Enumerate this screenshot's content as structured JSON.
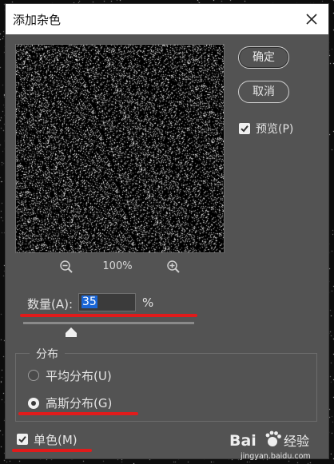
{
  "dialog": {
    "title": "添加杂色"
  },
  "buttons": {
    "ok_label": "确定",
    "cancel_label": "取消"
  },
  "preview": {
    "label": "预览(P)",
    "checked": true
  },
  "zoom": {
    "level": "100%"
  },
  "amount": {
    "label": "数量(A):",
    "value": "35",
    "unit": "%",
    "slider_value_percent": 35
  },
  "distribution": {
    "title": "分布",
    "options": [
      {
        "label": "平均分布(U)",
        "selected": false
      },
      {
        "label": "高斯分布(G)",
        "selected": true
      }
    ]
  },
  "monochromatic": {
    "label": "单色(M)",
    "checked": true
  },
  "watermark": {
    "brand": "Bai",
    "brand2": "经验",
    "url": "jingyan.baidu.com"
  },
  "colors": {
    "annotation_red": "#e01b1b",
    "selection_blue": "#1a66d6",
    "dialog_bg": "#535353"
  }
}
